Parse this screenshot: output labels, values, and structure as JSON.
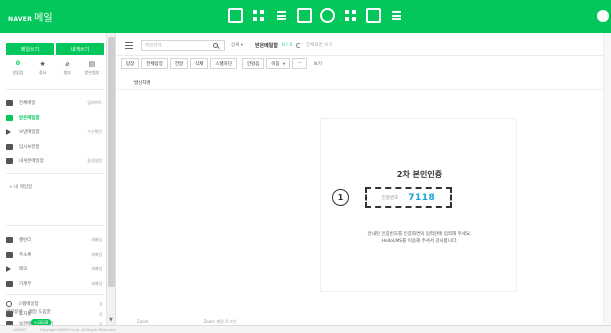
{
  "header": {
    "brand": "NAVER",
    "app_name": "메일",
    "apps": [
      {
        "name": "mail-app-icon",
        "shape": "sq"
      },
      {
        "name": "grid-app-icon",
        "shape": "grid"
      },
      {
        "name": "list-app-icon",
        "shape": "lines"
      },
      {
        "name": "calendar-app-icon",
        "shape": "sq"
      },
      {
        "name": "circle-app-icon",
        "shape": "circ"
      },
      {
        "name": "contacts-app-icon",
        "shape": "grid"
      },
      {
        "name": "home-app-icon",
        "shape": "sq"
      },
      {
        "name": "menu-app-icon",
        "shape": "lines"
      }
    ]
  },
  "sidebar": {
    "write_button": "메일쓰기",
    "self_write_button": "내게쓰기",
    "quick": [
      {
        "top": "0",
        "label": "안읽음",
        "is_count": true
      },
      {
        "top": "★",
        "label": "중요"
      },
      {
        "top": "⌀",
        "label": "첨부"
      },
      {
        "top": "▤",
        "label": "받은첨부"
      }
    ],
    "folders": [
      {
        "name": "전체메일",
        "count": "업데이트",
        "icon": "box"
      },
      {
        "name": "받은메일함",
        "count": "",
        "icon": "green",
        "active": true
      },
      {
        "name": "보낸메일함",
        "count": "수신확인",
        "icon": "tri"
      },
      {
        "name": "임시보관함",
        "count": "",
        "icon": "box"
      },
      {
        "name": "내게쓴메일함",
        "count": "환경설정",
        "icon": "box"
      }
    ],
    "add_folder": "+ 내 메일함",
    "folders2": [
      {
        "name": "캘린더",
        "count": "새메일",
        "icon": "box"
      },
      {
        "name": "주소록",
        "count": "새메일",
        "icon": "box"
      },
      {
        "name": "메모",
        "count": "새메일",
        "icon": "tri"
      },
      {
        "name": "가계부",
        "count": "새메일",
        "icon": "box"
      }
    ],
    "folders3": [
      {
        "name": "스팸메일함",
        "count": "0",
        "icon": "ring"
      },
      {
        "name": "휴지통",
        "count": "0",
        "icon": "box"
      },
      {
        "name": "보관메일 미리보기",
        "count": "0",
        "icon": "box"
      }
    ],
    "bottom_left": "메일용량",
    "bottom_right": "메일 도움말",
    "tag": "+20GB"
  },
  "toolbar": {
    "search_placeholder": "메일검색",
    "detail": "상세 ▾",
    "folder": "받은메일함",
    "count": "0 / 3",
    "full_screen": "전체화면 보기",
    "buttons": [
      "답장",
      "전체답장",
      "전달",
      "삭제",
      "스팸차단"
    ],
    "read_button": "안읽음",
    "move_button": "이동",
    "more_button": "···",
    "extra": "보기"
  },
  "content": {
    "sender_label": "발신자명",
    "auth_title": "2차 본인인증",
    "auth_label": "인증번호",
    "auth_code": "7118",
    "step_number": "1",
    "desc_line1": "안내된 인증번호를 인증화면의 입력란에 입력해 주세요.",
    "desc_line2": "HelloLMS를 이용해 주셔서 감사합니다."
  },
  "bottom": {
    "zoom_left": "Zoom",
    "zoom_right": "Zoom 계정 로그인",
    "status_items": [
      "NAVER",
      "Copyright NAVER Corp. All Rights Reserved."
    ]
  }
}
